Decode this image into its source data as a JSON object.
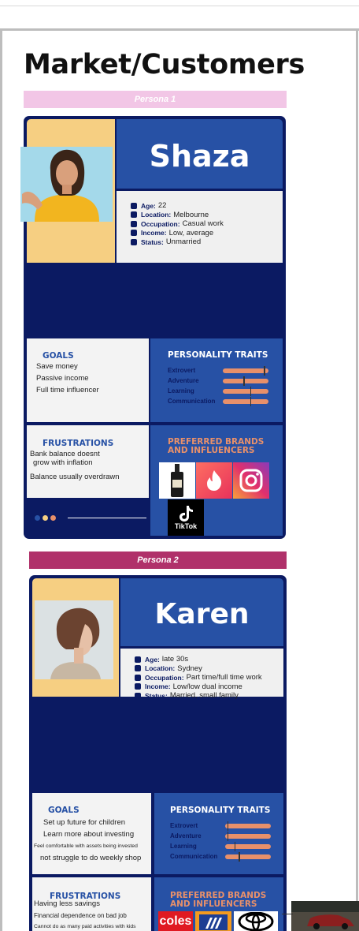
{
  "page_title": "Market/Customers",
  "colors": {
    "navy": "#0b1a62",
    "blue": "#2751a5",
    "sand": "#f6cf82",
    "coral": "#e8906a",
    "pink": "#f2c6e6",
    "magenta": "#b0316a"
  },
  "persona1": {
    "tag": "Persona 1",
    "name": "Shaza",
    "info": [
      {
        "label": "Age:",
        "value": "22",
        "icon": "user-icon"
      },
      {
        "label": "Location:",
        "value": "Melbourne",
        "icon": "location-pin-icon"
      },
      {
        "label": "Occupation:",
        "value": "Casual work",
        "icon": "briefcase-icon"
      },
      {
        "label": "Income:",
        "value": "Low, average",
        "icon": "dollar-icon"
      },
      {
        "label": "Status:",
        "value": "Unmarried",
        "icon": "moon-icon"
      }
    ],
    "goals_title": "GOALS",
    "goals": [
      "Save money",
      "Passive income",
      "Full time influencer"
    ],
    "traits_title": "PERSONALITY TRAITS",
    "traits": [
      {
        "name": "Extrovert",
        "level": 0.9
      },
      {
        "name": "Adventure",
        "level": 0.45
      },
      {
        "name": "Learning",
        "level": 0.6
      },
      {
        "name": "Communication",
        "level": 0.6
      }
    ],
    "frustrations_title": "FRUSTRATIONS",
    "frustrations": [
      "Bank balance doesnt",
      "grow with inflation",
      "Balance usually overdrawn"
    ],
    "brands_title_1": "PREFERRED BRANDS",
    "brands_title_2": "AND INFLUENCERS",
    "brands": [
      "Jack Daniel's",
      "Tinder",
      "Instagram",
      "TikTok"
    ],
    "tiktok_label": "TikTok"
  },
  "persona2": {
    "tag": "Persona 2",
    "name": "Karen",
    "info": [
      {
        "label": "Age:",
        "value": "late 30s",
        "icon": "user-icon"
      },
      {
        "label": "Location:",
        "value": "Sydney",
        "icon": "location-pin-icon"
      },
      {
        "label": "Occupation:",
        "value": "Part time/full time work",
        "icon": "briefcase-icon"
      },
      {
        "label": "Income:",
        "value": "Low/low dual income",
        "icon": "dollar-icon"
      },
      {
        "label": "Status:",
        "value": "Married, small family",
        "icon": "moon-icon"
      }
    ],
    "goals_title": "GOALS",
    "goals": [
      "Set up future for children",
      "Learn more about investing",
      "Feel comfortable with assets being invested",
      "not struggle to do weekly shop"
    ],
    "traits_title": "PERSONALITY TRAITS",
    "traits": [
      {
        "name": "Extrovert",
        "level": 0.05
      },
      {
        "name": "Adventure",
        "level": 0.05
      },
      {
        "name": "Learning",
        "level": 0.2
      },
      {
        "name": "Communication",
        "level": 0.3
      }
    ],
    "frustrations_title": "FRUSTRATIONS",
    "frustrations": [
      "Having less savings",
      "Financial dependence on bad job",
      "Cannot do as many paid activities with kids"
    ],
    "brands_title_1": "PREFERRED BRANDS",
    "brands_title_2": "AND INFLUENCERS",
    "brands": [
      "coles",
      "ALDI",
      "Toyota"
    ],
    "coles_label": "coles"
  }
}
